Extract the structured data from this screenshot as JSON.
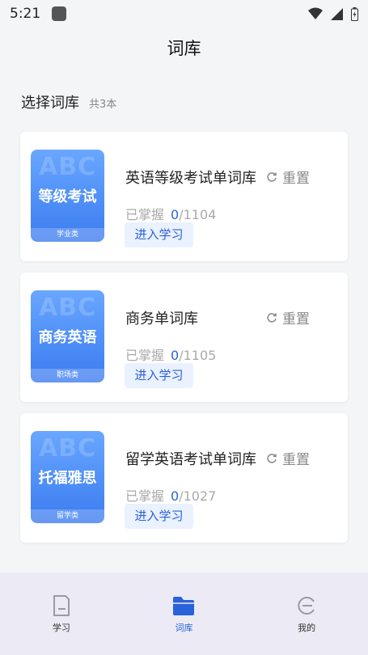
{
  "status_bar": {
    "time": "5:21"
  },
  "header": {
    "title": "词库"
  },
  "section": {
    "title": "选择词库",
    "count": "共3本"
  },
  "books": [
    {
      "cover_watermark": "ABC",
      "cover_title": "等级考试",
      "cover_category": "学业类",
      "name": "英语等级考试单词库",
      "reset_label": "重置",
      "mastered_label": "已掌握",
      "mastered": "0",
      "total": "/1104",
      "enter_label": "进入学习"
    },
    {
      "cover_watermark": "ABC",
      "cover_title": "商务英语",
      "cover_category": "职场类",
      "name": "商务单词库",
      "reset_label": "重置",
      "mastered_label": "已掌握",
      "mastered": "0",
      "total": "/1105",
      "enter_label": "进入学习"
    },
    {
      "cover_watermark": "ABC",
      "cover_title": "托福雅思",
      "cover_category": "留学类",
      "name": "留学英语考试单词库",
      "reset_label": "重置",
      "mastered_label": "已掌握",
      "mastered": "0",
      "total": "/1027",
      "enter_label": "进入学习"
    }
  ],
  "nav": [
    {
      "label": "学习",
      "icon": "study-icon",
      "active": false
    },
    {
      "label": "词库",
      "icon": "folder-icon",
      "active": true
    },
    {
      "label": "我的",
      "icon": "profile-icon",
      "active": false
    }
  ],
  "colors": {
    "accent": "#2a62d9",
    "cover": "#4f8ff7",
    "nav_bg": "#ebeaf5"
  }
}
